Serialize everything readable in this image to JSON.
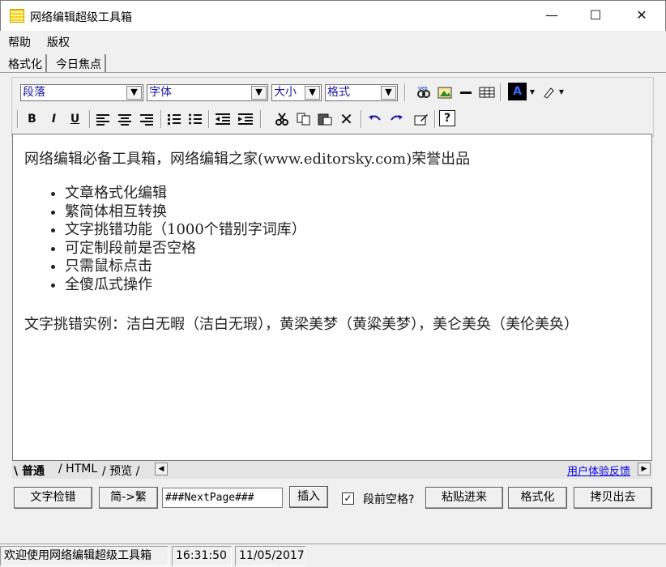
{
  "window": {
    "title": "网络编辑超级工具箱",
    "min_icon": "—",
    "max_icon": "☐",
    "close_icon": "✕"
  },
  "menu": {
    "help": "帮助",
    "copyright": "版权"
  },
  "tabs": [
    "格式化",
    "今日焦点"
  ],
  "toolbar": {
    "paragraph_select": "段落",
    "font_select": "字体",
    "size_select": "大小",
    "format_select": "格式",
    "dropdown_arrow": "▼",
    "icons": [
      "web-link-icon",
      "insert-image-icon",
      "horizontal-rule-icon",
      "insert-table-icon",
      "font-color-icon",
      "highlight-pen-icon",
      "bold-icon",
      "italic-icon",
      "underline-icon",
      "align-left-icon",
      "align-center-icon",
      "align-right-icon",
      "ordered-list-icon",
      "unordered-list-icon",
      "outdent-icon",
      "indent-icon",
      "cut-icon",
      "copy-icon",
      "paste-icon",
      "delete-icon",
      "undo-icon",
      "redo-icon",
      "edit-icon",
      "help-icon"
    ],
    "bold": "B",
    "italic": "I",
    "underline": "U",
    "delete": "✕",
    "help": "?",
    "font_color_letter": "A"
  },
  "editor": {
    "line1": "网络编辑必备工具箱，网络编辑之家(www.editorsky.com)荣誉出品",
    "bullets": [
      "文章格式化编辑",
      "繁简体相互转换",
      "文字挑错功能（1000个错别字词库）",
      "可定制段前是否空格",
      "只需鼠标点击",
      "全傻瓜式操作"
    ],
    "line2": "文字挑错实例：洁白无暇（洁白无瑕），黄梁美梦（黄粱美梦），美仑美奂（美伦美奂）"
  },
  "view_tabs": {
    "normal": "普通",
    "html": "HTML",
    "preview": "预览",
    "feedback": "用户体验反馈",
    "scroll_left": "◀",
    "scroll_right": "▶"
  },
  "actions": {
    "spellcheck": "文字检错",
    "convert": "简->繁",
    "nextpage_value": "###NextPage###",
    "insert": "插入",
    "indent_label": "段前空格?",
    "indent_checked": true,
    "checkmark": "✓",
    "paste_in": "粘贴进来",
    "format": "格式化",
    "copy_out": "拷贝出去"
  },
  "status": {
    "welcome": "欢迎使用网络编辑超级工具箱",
    "time": "16:31:50",
    "date": "11/05/2017"
  }
}
